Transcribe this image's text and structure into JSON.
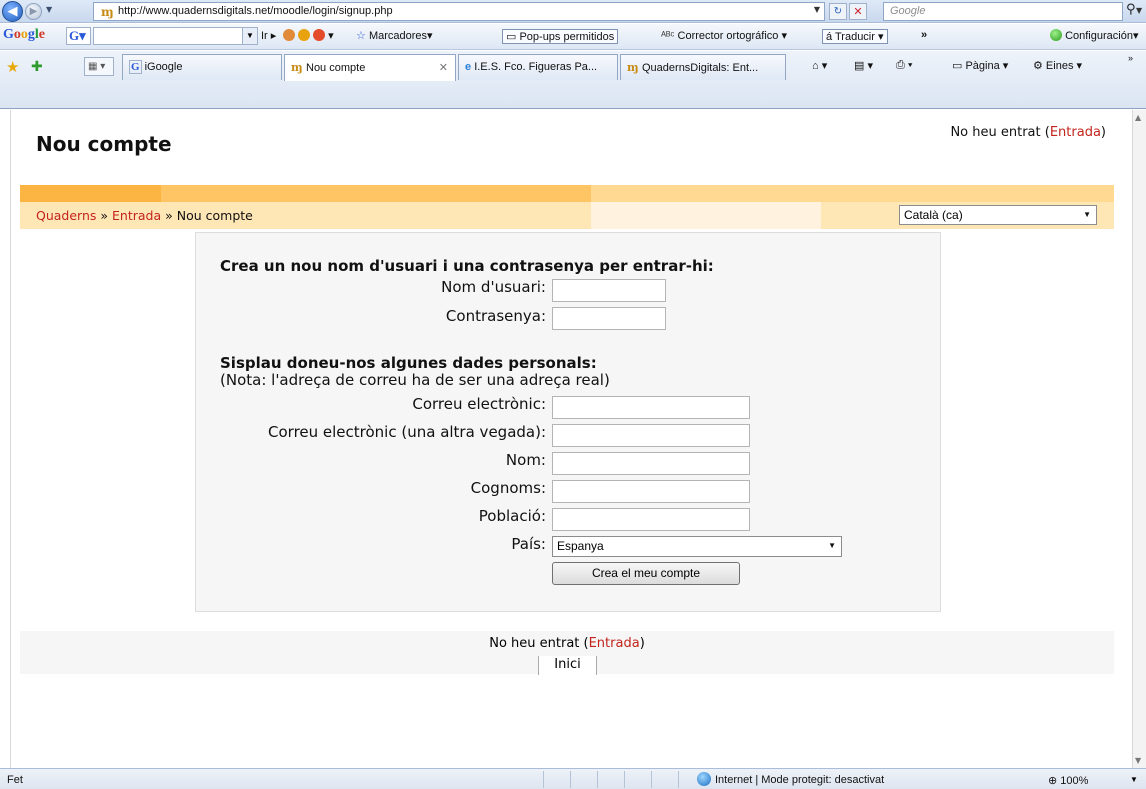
{
  "browser": {
    "url": "http://www.quadernsdigitals.net/moodle/login/signup.php",
    "search_placeholder": "Google",
    "toolbar": {
      "google_logo": "Google",
      "google_button": "G",
      "go_label": "Ir",
      "bookmarks_label": "Marcadores",
      "popups_label": "Pop-ups permitidos",
      "spellcheck_label": "Corrector ortográfico",
      "translate_label": "Traducir",
      "more_label": "»",
      "settings_label": "Configuración"
    },
    "tabs": [
      {
        "label": "iGoogle"
      },
      {
        "label": "Nou compte"
      },
      {
        "label": "I.E.S. Fco. Figueras Pa..."
      },
      {
        "label": "QuadernsDigitals: Ent..."
      }
    ],
    "commands": {
      "page_label": "Pàgina",
      "tools_label": "Eines"
    },
    "status": {
      "text": "Fet",
      "zone": "Internet | Mode protegit: desactivat",
      "zoom": "100%"
    }
  },
  "page": {
    "title": "Nou compte",
    "login_status": {
      "prefix": "No heu entrat (",
      "link": "Entrada",
      "suffix": ")"
    },
    "breadcrumb": {
      "home": "Quaderns",
      "sep1": " » ",
      "login": "Entrada",
      "sep2": " » ",
      "current": "Nou compte"
    },
    "language": "Català (ca)",
    "form": {
      "section1_heading": "Crea un nou nom d'usuari i una contrasenya per entrar-hi:",
      "username_label": "Nom d'usuari:",
      "password_label": "Contrasenya:",
      "section2_heading": "Sisplau doneu-nos algunes dades personals:",
      "section2_note": "(Nota: l'adreça de correu ha de ser una adreça real)",
      "email_label": "Correu electrònic:",
      "email_again_label": "Correu electrònic (una altra vegada):",
      "firstname_label": "Nom:",
      "lastname_label": "Cognoms:",
      "city_label": "Població:",
      "country_label": "País:",
      "country_value": "Espanya",
      "submit_label": "Crea el meu compte"
    },
    "footer": {
      "prefix": "No heu entrat (",
      "link": "Entrada",
      "suffix": ")",
      "home": "Inici"
    }
  }
}
